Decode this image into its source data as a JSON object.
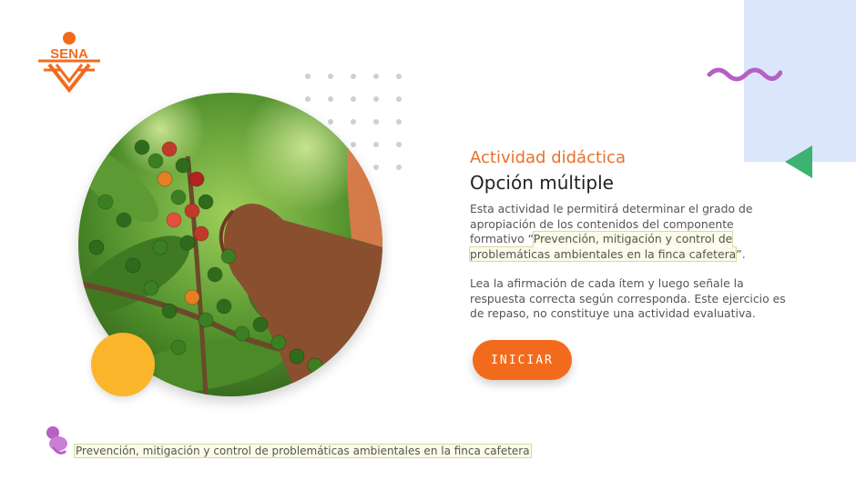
{
  "logo": {
    "text": "SENA",
    "color": "#f26b1d"
  },
  "activity": {
    "eyebrow": "Actividad didáctica",
    "title": "Opción múltiple",
    "p1_before": "Esta actividad le permitirá determinar el grado de apropiación de los contenidos del componente formativo “",
    "p1_link": "Prevención, mitigación y control de problemáticas ambientales en la finca cafetera",
    "p1_after": "”.",
    "p2": "Lea la afirmación de cada ítem y luego señale la respuesta correcta según corresponda.  Este ejercicio es de repaso, no constituye una actividad evaluativa."
  },
  "button": {
    "label": "INICIAR"
  },
  "footer": {
    "text": "Prevención, mitigación y control de problemáticas ambientales en la finca cafetera"
  },
  "icons": {
    "logo": "sena-logo-icon",
    "photo": "coffee-harvest-photo",
    "squiggle": "squiggle-icon",
    "triangle": "triangle-icon",
    "footer": "bubble-figure-icon"
  },
  "colors": {
    "accent": "#f26b1d",
    "eyebrow": "#e8712c",
    "panel": "#dbe6fd",
    "yellow": "#fbb52b",
    "purple": "#b660c4",
    "green": "#3cb371"
  }
}
